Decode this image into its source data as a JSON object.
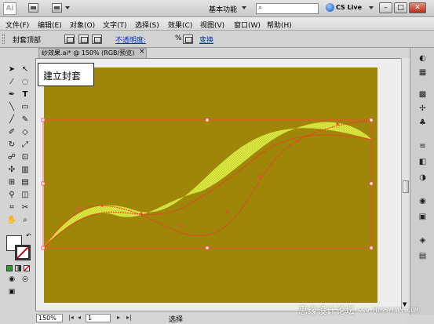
{
  "app": {
    "logo": "Ai",
    "workspace": "基本功能",
    "cs_live": "CS Live"
  },
  "menus": [
    "文件(F)",
    "编辑(E)",
    "对象(O)",
    "文字(T)",
    "选择(S)",
    "效果(C)",
    "视图(V)",
    "窗口(W)",
    "帮助(H)"
  ],
  "control": {
    "label": "封套顶部",
    "opacity_label": "不透明度:",
    "opacity_value": "100",
    "opacity_unit": "%",
    "transform_link": "变换"
  },
  "document": {
    "tab_title": "纱效果.ai* @ 150% (RGB/预览)",
    "tab_close": "×",
    "tooltip": "建立封套",
    "artboard_color": "#9e8608",
    "curve_color": "#ddf028",
    "envelope_color": "#ff3030"
  },
  "status": {
    "zoom": "150%",
    "page": "1",
    "selection": "选择",
    "first": "|◂",
    "prev": "◂",
    "next": "▸",
    "last": "▸|"
  },
  "watermark": {
    "text": "思缘设计论坛",
    "site": "www.MISSYUAN.COM"
  },
  "icons": {
    "tools": [
      "selection-icon",
      "direct-selection-icon",
      "magic-wand-icon",
      "lasso-icon",
      "pen-icon",
      "type-icon",
      "line-icon",
      "rectangle-icon",
      "paintbrush-icon",
      "pencil-icon",
      "blob-brush-icon",
      "eraser-icon",
      "rotate-icon",
      "scale-icon",
      "warp-icon",
      "free-transform-icon",
      "symbol-sprayer-icon",
      "graph-icon",
      "mesh-icon",
      "gradient-icon",
      "eyedropper-icon",
      "blend-icon",
      "slice-icon",
      "scissors-icon",
      "hand-icon",
      "zoom-icon"
    ],
    "dock": [
      "color-icon",
      "color-guide-icon",
      "swatches-icon",
      "brushes-icon",
      "symbols-icon",
      "stroke-icon",
      "gradient-panel-icon",
      "transparency-icon",
      "appearance-icon",
      "graphic-styles-icon",
      "layers-icon",
      "artboards-icon"
    ]
  }
}
